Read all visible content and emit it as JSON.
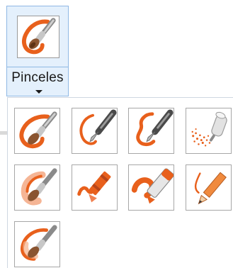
{
  "ribbon": {
    "brushes_button": {
      "label": "Pinceles",
      "icon": "brush-icon"
    }
  },
  "brushes_gallery": {
    "items": [
      {
        "icon": "brush-icon"
      },
      {
        "icon": "calligraphy-brush-1-icon"
      },
      {
        "icon": "calligraphy-brush-2-icon"
      },
      {
        "icon": "airbrush-icon"
      },
      {
        "icon": "oil-brush-icon"
      },
      {
        "icon": "crayon-icon"
      },
      {
        "icon": "marker-icon"
      },
      {
        "icon": "natural-pencil-icon"
      },
      {
        "icon": "watercolor-brush-icon"
      }
    ]
  },
  "colors": {
    "accent_orange": "#e8601c",
    "selection_blue": "#8fb8e4"
  }
}
